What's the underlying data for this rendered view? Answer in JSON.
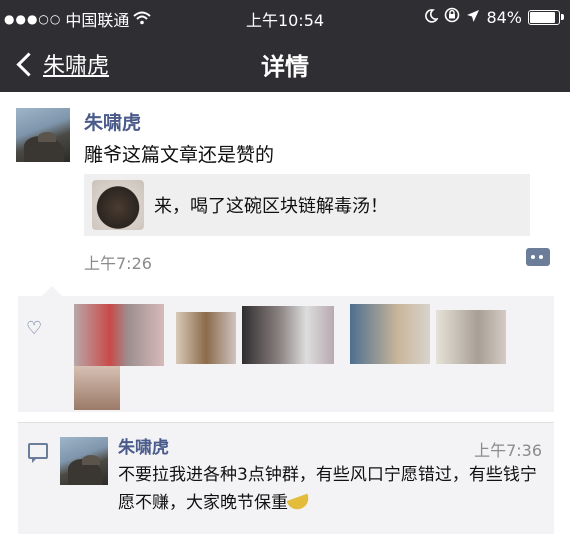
{
  "status_bar": {
    "signal_dots": "●●●○○",
    "carrier": "中国联通",
    "wifi_icon": "wifi-icon",
    "time": "上午10:54",
    "moon_icon": "moon-icon",
    "lock_icon": "rotation-lock-icon",
    "location_icon": "location-arrow-icon",
    "battery_percent_text": "84%",
    "battery_level": 0.84
  },
  "nav": {
    "back_label": "朱啸虎",
    "title": "详情"
  },
  "post": {
    "author": "朱啸虎",
    "text": "雕爷这篇文章还是赞的",
    "link_title": "来，喝了这碗区块链解毒汤！",
    "time": "上午7:26"
  },
  "likes": {
    "heart_icon": "heart-outline-icon"
  },
  "comment": {
    "author": "朱啸虎",
    "time": "上午7:36",
    "text": "不要拉我进各种3点钟群，有些风口宁愿错过，有些钱宁愿不赚，大家晚节保重",
    "emoji": "banana-emoji"
  },
  "colors": {
    "nav_bg": "#2e2e33",
    "author_blue": "#4a5b8a",
    "panel_bg": "#f3f3f5"
  }
}
